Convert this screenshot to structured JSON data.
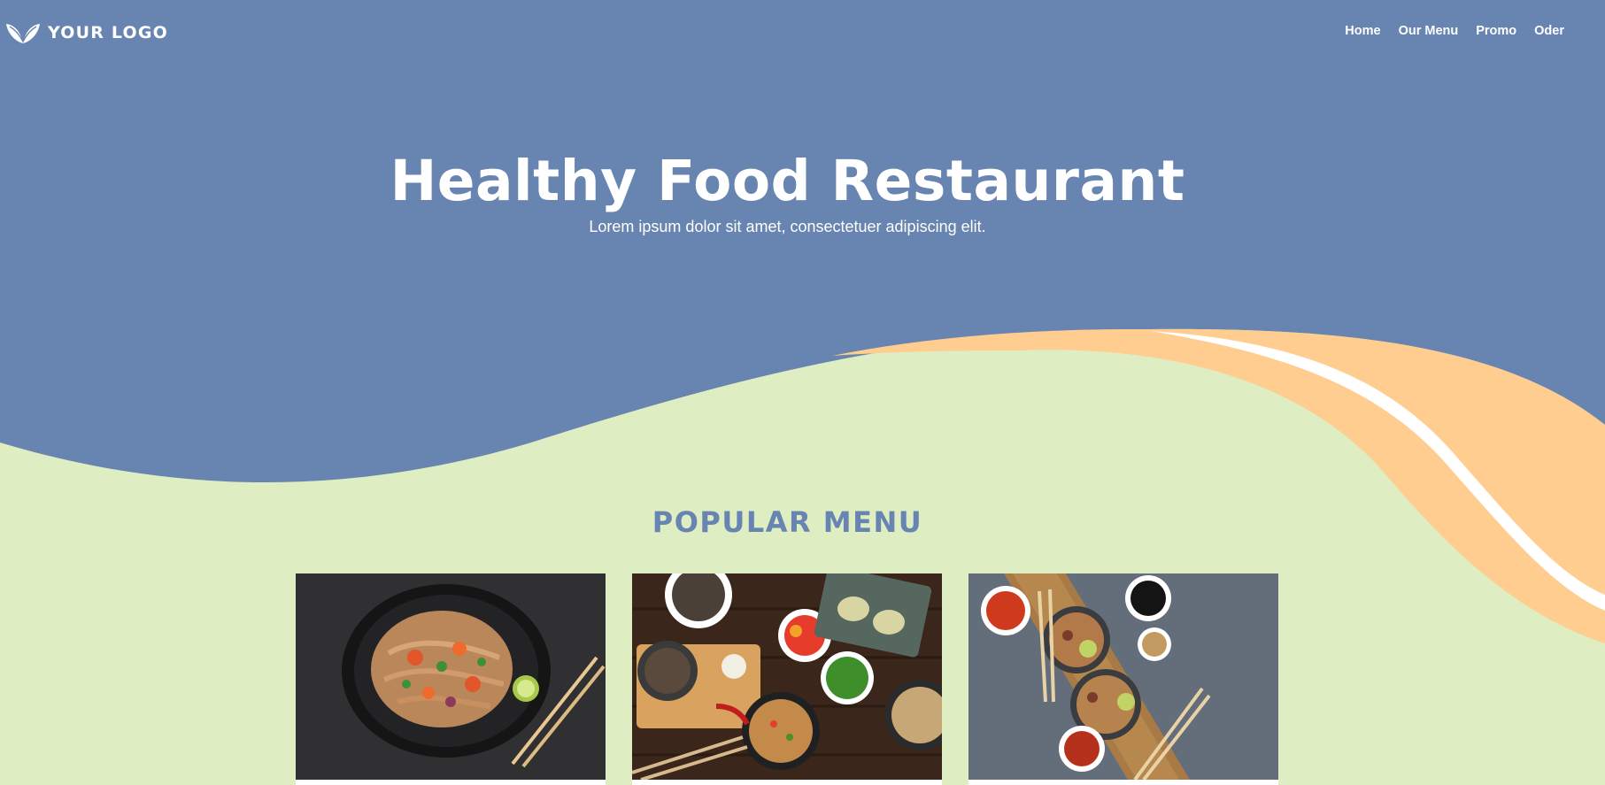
{
  "header": {
    "logo_text": "YOUR LOGO",
    "logo_icon": "leaf-icon",
    "nav": [
      "Home",
      "Our Menu",
      "Promo",
      "Oder"
    ]
  },
  "hero": {
    "title": "Healthy Food Restaurant",
    "subtitle": "Lorem ipsum dolor sit amet, consectetuer adipiscing elit."
  },
  "popular": {
    "title": "POPULAR MENU",
    "cards": [
      "noodle-plate-image",
      "assorted-dishes-image",
      "bowls-on-mat-image"
    ]
  },
  "colors": {
    "hero_blue": "#6785b0",
    "light_green": "#dfedc2",
    "peach": "#fecd8f",
    "white": "#ffffff"
  }
}
